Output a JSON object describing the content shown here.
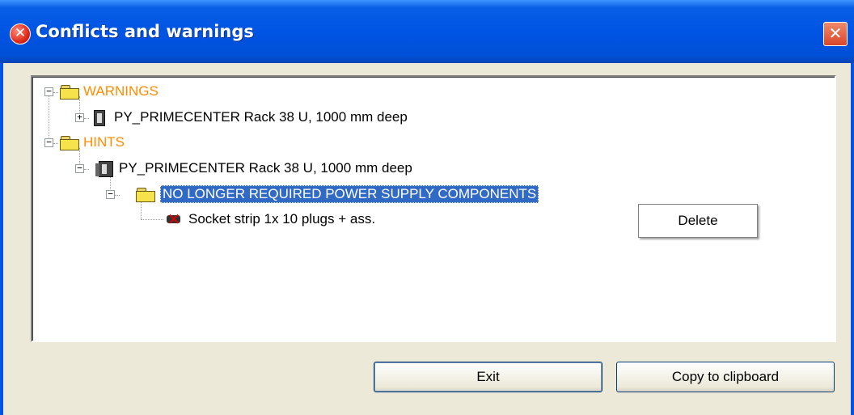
{
  "window": {
    "title": "Conflicts and warnings",
    "title_icon": "error-icon",
    "close_icon": "close-icon"
  },
  "tree": {
    "nodes": [
      {
        "label": "WARNINGS",
        "icon": "folder-open-icon",
        "expander": "−",
        "color": "#ff8c00"
      },
      {
        "label": "PY_PRIMECENTER Rack 38 U, 1000 mm deep",
        "icon": "rack-icon",
        "expander": "+"
      },
      {
        "label": "HINTS",
        "icon": "folder-open-icon",
        "expander": "−",
        "color": "#ff8c00"
      },
      {
        "label": "PY_PRIMECENTER Rack 38 U, 1000 mm deep",
        "icon": "rack-multi-icon",
        "expander": "−"
      },
      {
        "label": "NO LONGER REQUIRED POWER SUPPLY COMPONENTS",
        "icon": "folder-open-icon",
        "expander": "−",
        "selected": true
      },
      {
        "label": "Socket strip 1x 10 plugs + ass.",
        "icon": "socket-strip-removed-icon"
      }
    ]
  },
  "context_menu": {
    "items": [
      "Delete"
    ]
  },
  "buttons": {
    "exit": "Exit",
    "copy": "Copy to clipboard"
  }
}
